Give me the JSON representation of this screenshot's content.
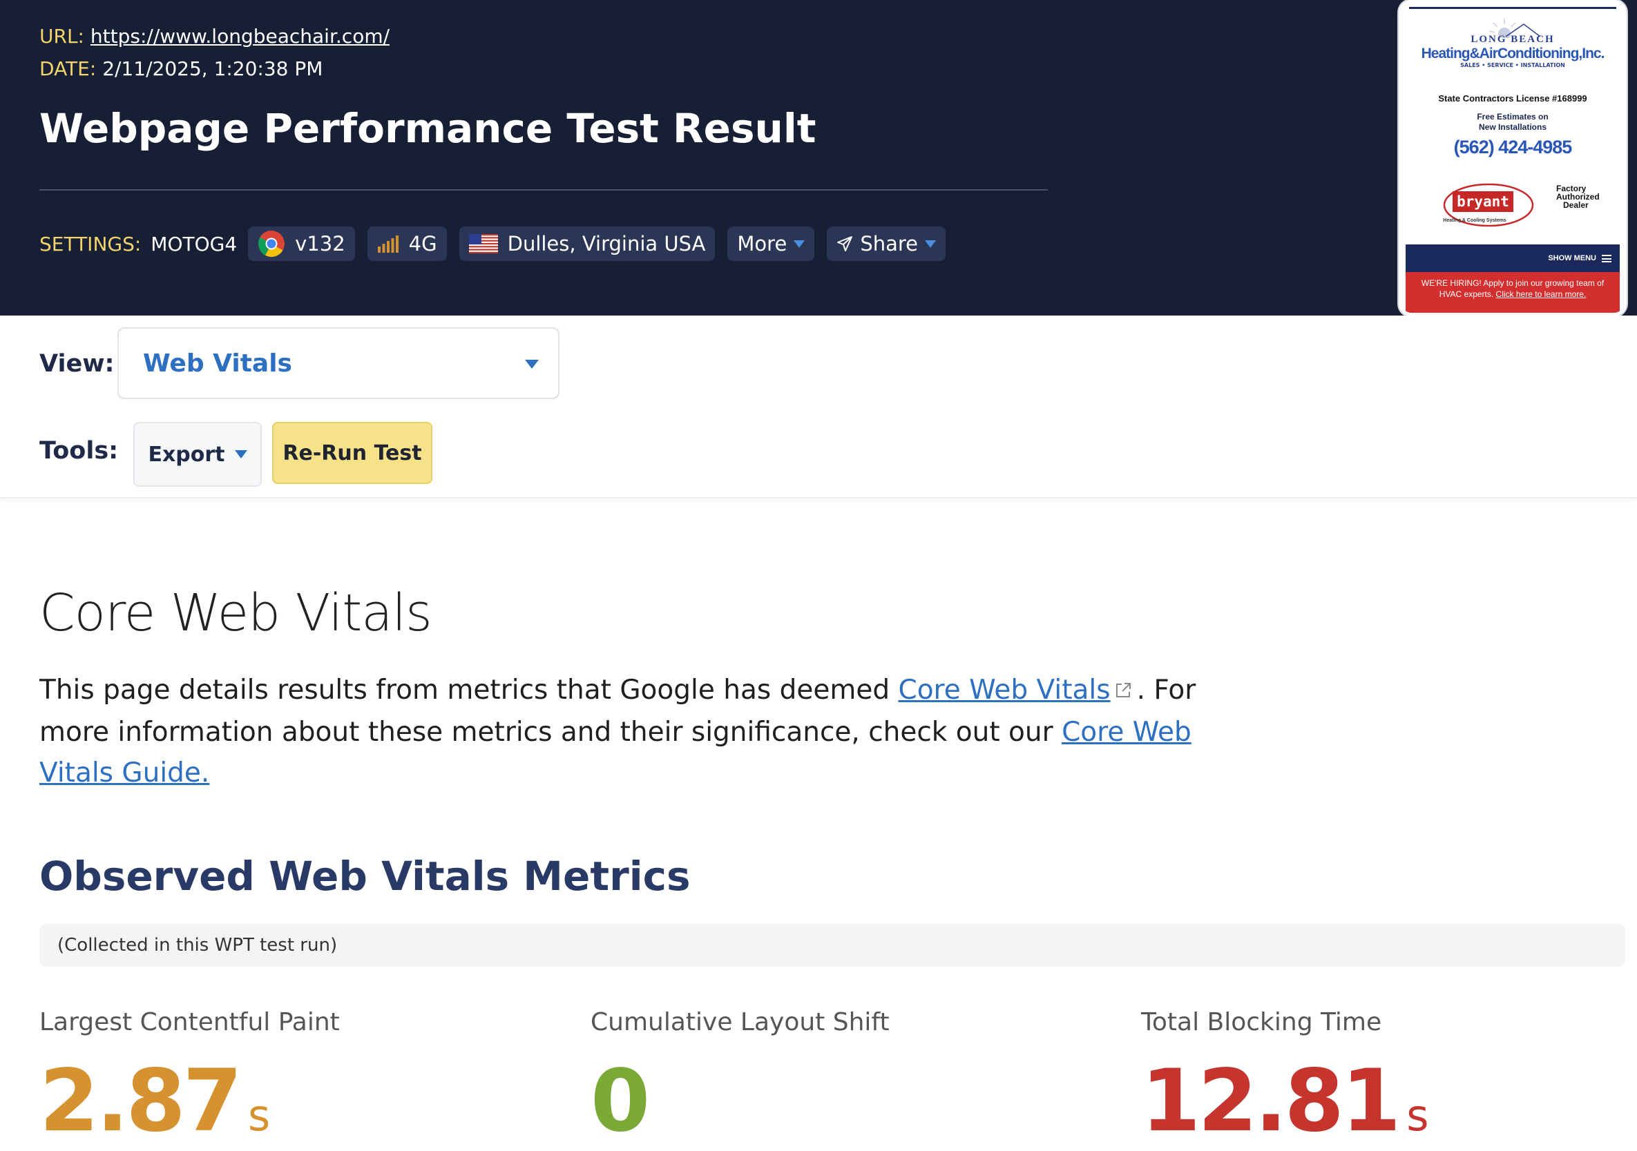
{
  "header": {
    "url_key": "URL:",
    "url": "https://www.longbeachair.com/",
    "date_key": "DATE:",
    "date": "2/11/2025, 1:20:38 PM",
    "title": "Webpage Performance Test Result"
  },
  "settings": {
    "label": "SETTINGS:",
    "device": "MOTOG4",
    "browser": "v132",
    "browser_icon": "chrome-icon",
    "connection": "4G",
    "connection_icon": "signal-bars-icon",
    "location": "Dulles, Virginia USA",
    "location_icon": "us-flag-icon",
    "more": "More",
    "share": "Share",
    "share_icon": "send-icon"
  },
  "thumbnail": {
    "logo_line1": "LONG BEACH",
    "logo_line2": "Heating&AirConditioning,Inc.",
    "logo_line3": "SALES • SERVICE • INSTALLATION",
    "license": "State Contractors License #168999",
    "free_line1": "Free Estimates on",
    "free_line2": "New Installations",
    "phone": "(562) 424-4985",
    "bryant": "bryant",
    "bryant_sub": "Heating & Cooling Systems",
    "dealer": "Factory Authorized Dealer",
    "menu": "SHOW MENU",
    "hiring": "WE'RE HIRING! Apply to join our growing team of HVAC experts.",
    "hiring_link": "Click here to learn more."
  },
  "view": {
    "label": "View:",
    "selected": "Web Vitals"
  },
  "tools": {
    "label": "Tools:",
    "export": "Export",
    "rerun": "Re-Run Test"
  },
  "content": {
    "title": "Core Web Vitals",
    "desc_part1": "This page details results from metrics that Google has deemed ",
    "desc_link1": "Core Web Vitals",
    "desc_part2": ". For more information about these metrics and their significance, check out our ",
    "desc_link2": "Core Web Vitals Guide.",
    "observed_title": "Observed Web Vitals Metrics",
    "collected_note": "(Collected in this WPT test run)"
  },
  "metrics": [
    {
      "label": "Largest Contentful Paint",
      "value": "2.87",
      "unit": "s",
      "color": "#d6922e"
    },
    {
      "label": "Cumulative Layout Shift",
      "value": "0",
      "unit": "",
      "color": "#7aa936"
    },
    {
      "label": "Total Blocking Time",
      "value": "12.81",
      "unit": "s",
      "color": "#c5342d"
    }
  ],
  "colors": {
    "header_bg": "#171f35",
    "accent_yellow": "#f3d36b",
    "link_blue": "#2d6fc0",
    "chip_bg": "#2b3656"
  }
}
